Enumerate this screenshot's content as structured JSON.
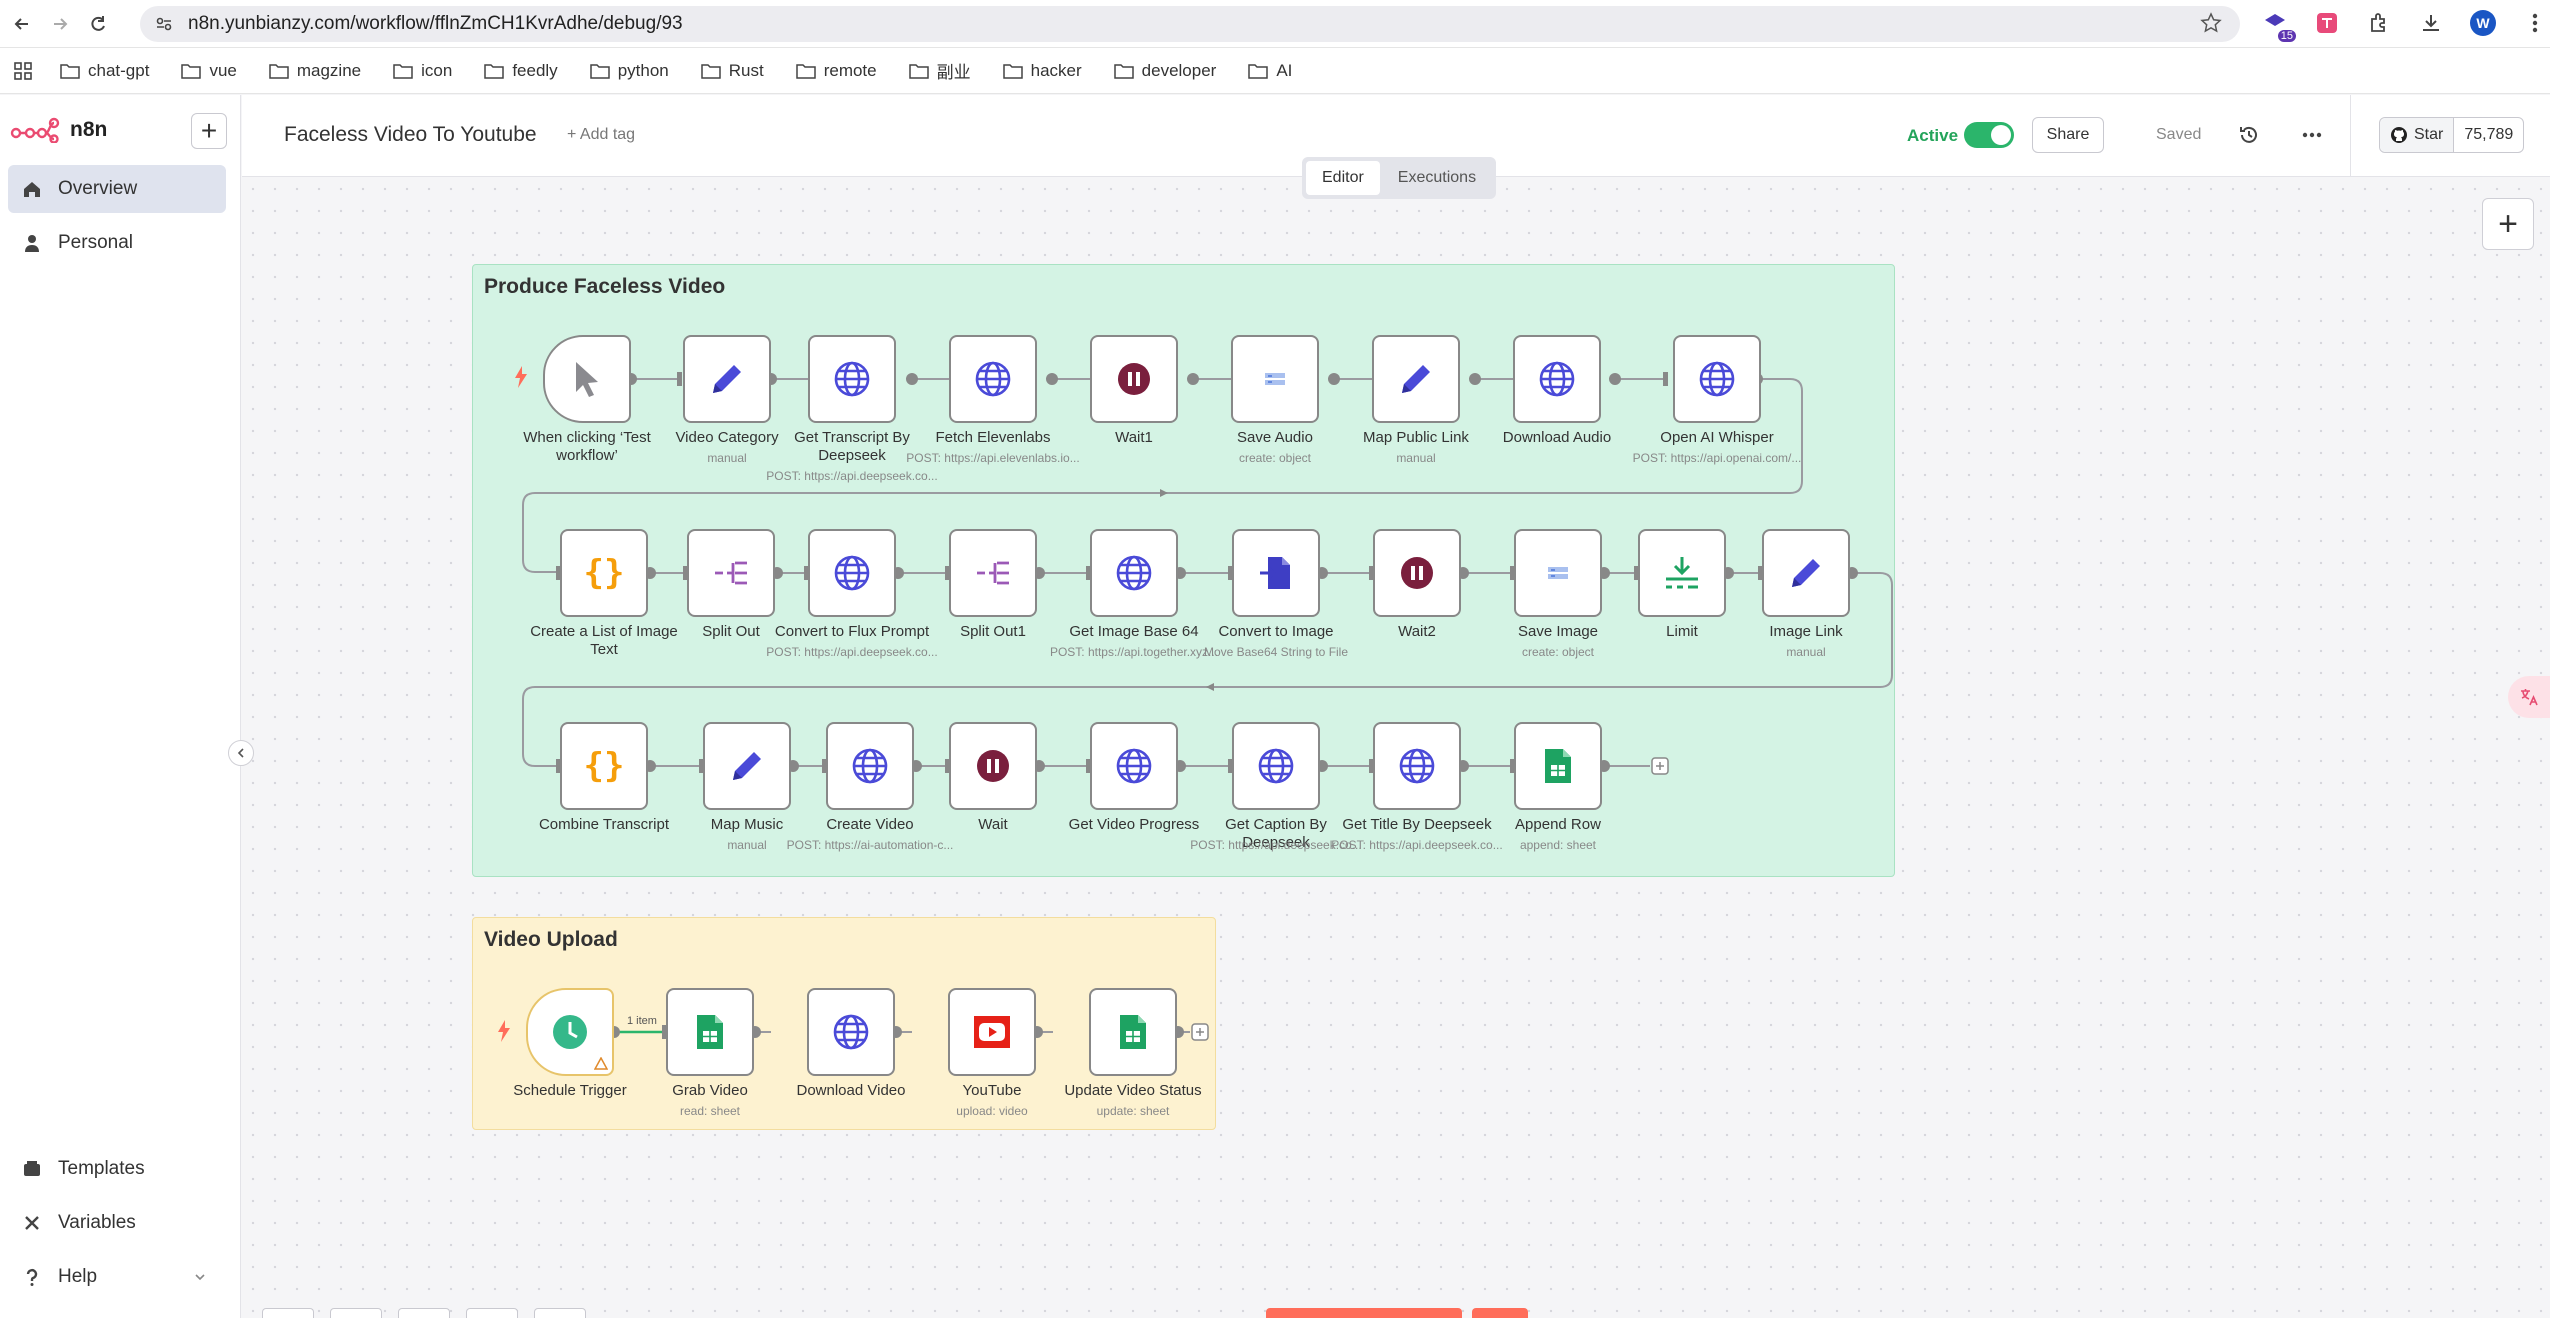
{
  "browser": {
    "url": "n8n.yunbianzy.com/workflow/fflnZmCH1KvrAdhe/debug/93",
    "extension_badge": "15",
    "profile_initial": "W",
    "bookmarks": [
      "chat-gpt",
      "vue",
      "magzine",
      "icon",
      "feedly",
      "python",
      "Rust",
      "remote",
      "副业",
      "hacker",
      "developer",
      "AI"
    ]
  },
  "sidebar": {
    "brand": "n8n",
    "new_button": "+",
    "items": [
      "Overview",
      "Personal"
    ],
    "bottom_items": [
      "Templates",
      "Variables",
      "Help"
    ]
  },
  "header": {
    "workflow_title": "Faceless Video To Youtube",
    "add_tag": "+ Add tag",
    "active_label": "Active",
    "active": true,
    "share": "Share",
    "saved": "Saved",
    "github_star": "Star",
    "github_count": "75,789",
    "tabs": [
      "Editor",
      "Executions"
    ]
  },
  "canvas": {
    "sticky_notes": [
      "Produce Faceless Video",
      "Video Upload"
    ],
    "connection_label": "1 item",
    "nodes": [
      {
        "label": "When clicking ‘Test workflow’",
        "sub": "",
        "icon": "cursor-icon"
      },
      {
        "label": "Video Category",
        "sub": "manual",
        "icon": "pencil-icon"
      },
      {
        "label": "Get Transcript By Deepseek",
        "sub": "POST: https://api.deepseek.co...",
        "icon": "globe-icon"
      },
      {
        "label": "Fetch Elevenlabs",
        "sub": "POST: https://api.elevenlabs.io...",
        "icon": "globe-icon"
      },
      {
        "label": "Wait1",
        "sub": "",
        "icon": "pause-icon"
      },
      {
        "label": "Save Audio",
        "sub": "create: object",
        "icon": "storage-icon"
      },
      {
        "label": "Map Public Link",
        "sub": "manual",
        "icon": "pencil-icon"
      },
      {
        "label": "Download Audio",
        "sub": "",
        "icon": "globe-icon"
      },
      {
        "label": "Open AI Whisper",
        "sub": "POST: https://api.openai.com/...",
        "icon": "globe-icon"
      },
      {
        "label": "Create a List of Image Text",
        "sub": "",
        "icon": "code-icon"
      },
      {
        "label": "Split Out",
        "sub": "",
        "icon": "split-icon"
      },
      {
        "label": "Convert to Flux Prompt",
        "sub": "POST: https://api.deepseek.co...",
        "icon": "globe-icon"
      },
      {
        "label": "Split Out1",
        "sub": "",
        "icon": "split-icon"
      },
      {
        "label": "Get Image Base 64",
        "sub": "POST: https://api.together.xyz...",
        "icon": "globe-icon"
      },
      {
        "label": "Convert to Image",
        "sub": "Move Base64 String to File",
        "icon": "file-convert-icon"
      },
      {
        "label": "Wait2",
        "sub": "",
        "icon": "pause-icon"
      },
      {
        "label": "Save Image",
        "sub": "create: object",
        "icon": "storage-icon"
      },
      {
        "label": "Limit",
        "sub": "",
        "icon": "limit-icon"
      },
      {
        "label": "Image Link",
        "sub": "manual",
        "icon": "pencil-icon"
      },
      {
        "label": "Combine Transcript",
        "sub": "",
        "icon": "code-icon"
      },
      {
        "label": "Map Music",
        "sub": "manual",
        "icon": "pencil-icon"
      },
      {
        "label": "Create Video",
        "sub": "POST: https://ai-automation-c...",
        "icon": "globe-icon"
      },
      {
        "label": "Wait",
        "sub": "",
        "icon": "pause-icon"
      },
      {
        "label": "Get Video Progress",
        "sub": "",
        "icon": "globe-icon"
      },
      {
        "label": "Get Caption By Deepseek",
        "sub": "POST: https://api.deepseek.co...",
        "icon": "globe-icon"
      },
      {
        "label": "Get Title By Deepseek",
        "sub": "POST: https://api.deepseek.co...",
        "icon": "globe-icon"
      },
      {
        "label": "Append Row",
        "sub": "append: sheet",
        "icon": "sheets-icon"
      },
      {
        "label": "Schedule Trigger",
        "sub": "",
        "icon": "clock-icon"
      },
      {
        "label": "Grab Video",
        "sub": "read: sheet",
        "icon": "sheets-icon"
      },
      {
        "label": "Download Video",
        "sub": "",
        "icon": "globe-icon"
      },
      {
        "label": "YouTube",
        "sub": "upload: video",
        "icon": "youtube-icon"
      },
      {
        "label": "Update Video Status",
        "sub": "update: sheet",
        "icon": "sheets-icon"
      }
    ]
  },
  "colors": {
    "accent": "#ff6d5a",
    "active_green": "#2bb56b",
    "sticky_green": "#d4f3e4",
    "sticky_yellow": "#fdf2d0",
    "node_blue": "#4a4ad8",
    "wait_maroon": "#7a1f3d",
    "code_orange": "#f59e0b",
    "sheets_green": "#1ea362",
    "youtube_red": "#e62117"
  }
}
